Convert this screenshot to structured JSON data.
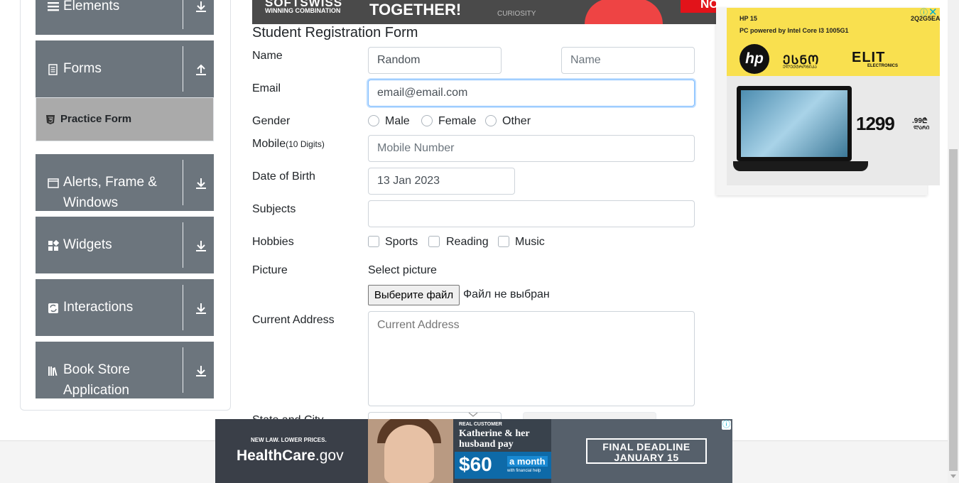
{
  "sidebar": {
    "groups": [
      {
        "title": "Elements",
        "icon": "list-icon",
        "arrow": "download-arrow-icon"
      },
      {
        "title": "Forms",
        "icon": "document-icon",
        "arrow": "upload-arrow-icon"
      },
      {
        "title": "Alerts, Frame &",
        "title2": "Windows",
        "icon": "window-icon",
        "arrow": "download-arrow-icon"
      },
      {
        "title": "Widgets",
        "icon": "widgets-icon",
        "arrow": "download-arrow-icon"
      },
      {
        "title": "Interactions",
        "icon": "interactions-icon",
        "arrow": "download-arrow-icon"
      },
      {
        "title": "Book Store",
        "title2": "Application",
        "icon": "books-icon",
        "arrow": "download-arrow-icon"
      }
    ],
    "active_item": {
      "label": "Practice Form",
      "icon": "html5-icon"
    }
  },
  "top_banner": {
    "brand": "SOFTSWISS",
    "tagline": "WINNING COMBINATION",
    "headline": "TOGETHER!",
    "small": "CURIOSITY",
    "corner": "NO"
  },
  "form": {
    "title": "Student Registration Form",
    "name_label": "Name",
    "first_name_value": "Random",
    "last_name_placeholder": "Name",
    "email_label": "Email",
    "email_value": "email@email.com",
    "gender_label": "Gender",
    "gender_options": [
      "Male",
      "Female",
      "Other"
    ],
    "mobile_label": "Mobile",
    "mobile_hint": "(10 Digits)",
    "mobile_placeholder": "Mobile Number",
    "dob_label": "Date of Birth",
    "dob_value": "13 Jan 2023",
    "subjects_label": "Subjects",
    "hobbies_label": "Hobbies",
    "hobby_options": [
      "Sports",
      "Reading",
      "Music"
    ],
    "picture_label": "Picture",
    "picture_hint": "Select picture",
    "file_button": "Выберите файл",
    "file_status": "Файл не выбран",
    "address_label": "Current Address",
    "address_placeholder": "Current Address",
    "state_city_label": "State and City"
  },
  "right_ad": {
    "title": "HP 15",
    "subtitle": "PC powered by Intel Core I3 1005G1",
    "code": "2Q2G5EA",
    "hp_logo": "hp",
    "shop": "ᲔᲡᲜᲝ",
    "shop_sub": "ᲔᲚᲔᲥᲢᲠᲝᲜᲘᲙᲐ",
    "elit": "ELIT",
    "elit_sub": "ELECTRONICS",
    "price": "1299",
    "cents": ".99₾",
    "price_unit": "ᲚᲐᲠᲘ",
    "info_icon": "ⓘ",
    "close_icon": "✕"
  },
  "bottom_ad": {
    "law": "NEW LAW. LOWER PRICES.",
    "site_main": "HealthCare",
    "site_tld": ".gov",
    "real_customer": "REAL CUSTOMER",
    "story": "Katherine & her husband pay",
    "price": "$60",
    "per": "a month",
    "help": "with financial help",
    "deadline_1": "FINAL DEADLINE",
    "deadline_2": "JANUARY 15",
    "info_icon": "ⓘ"
  },
  "colors": {
    "sidebar_group": "#6c757d",
    "active_item": "#aaaaaa",
    "focus_border": "#80bdff"
  }
}
